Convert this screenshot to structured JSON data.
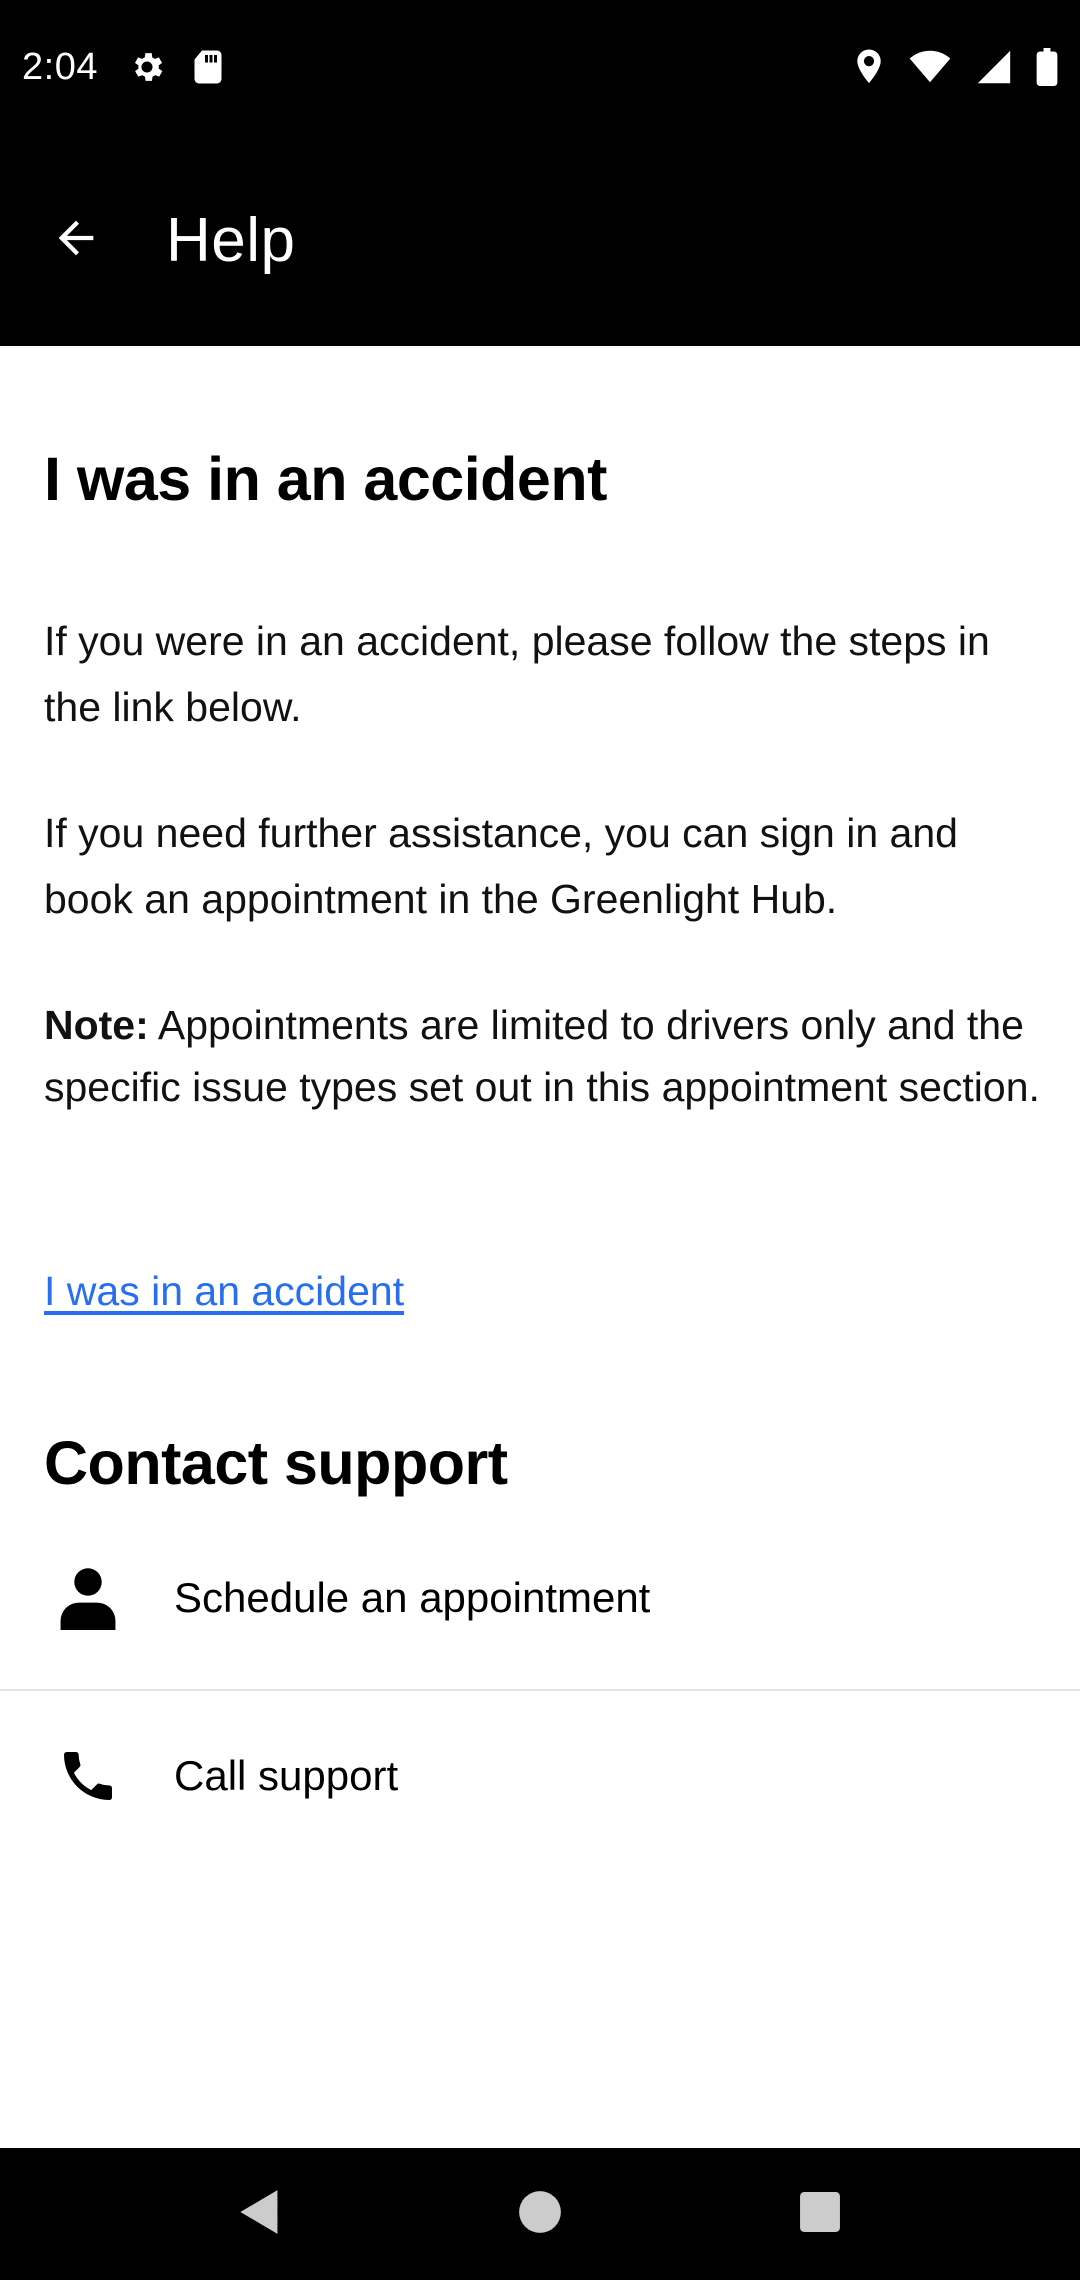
{
  "status_bar": {
    "time": "2:04",
    "left_icons": [
      "settings-icon",
      "sd-card-icon"
    ],
    "right_icons": [
      "location-icon",
      "wifi-icon",
      "signal-icon",
      "battery-icon"
    ]
  },
  "app_bar": {
    "title": "Help",
    "back_icon": "arrow-left-icon"
  },
  "article": {
    "title": "I was in an accident",
    "paragraph_1": "If you were in an accident, please follow the steps in the link below.",
    "paragraph_2": "If you need further assistance, you can sign in and book an appointment in the Greenlight Hub.",
    "note_label": "Note:",
    "note_text": " Appointments are limited to drivers only and the specific issue types set out in this appointment section.",
    "link_label": "I was in an accident"
  },
  "contact": {
    "title": "Contact support",
    "items": [
      {
        "label": "Schedule an appointment",
        "icon": "person-icon"
      },
      {
        "label": "Call support",
        "icon": "phone-icon"
      }
    ]
  },
  "colors": {
    "link": "#276ef1",
    "bar_background": "#000000",
    "divider": "#e2e2e2"
  },
  "nav_bar": {
    "buttons": [
      "back-triangle-icon",
      "home-circle-icon",
      "recents-square-icon"
    ]
  }
}
